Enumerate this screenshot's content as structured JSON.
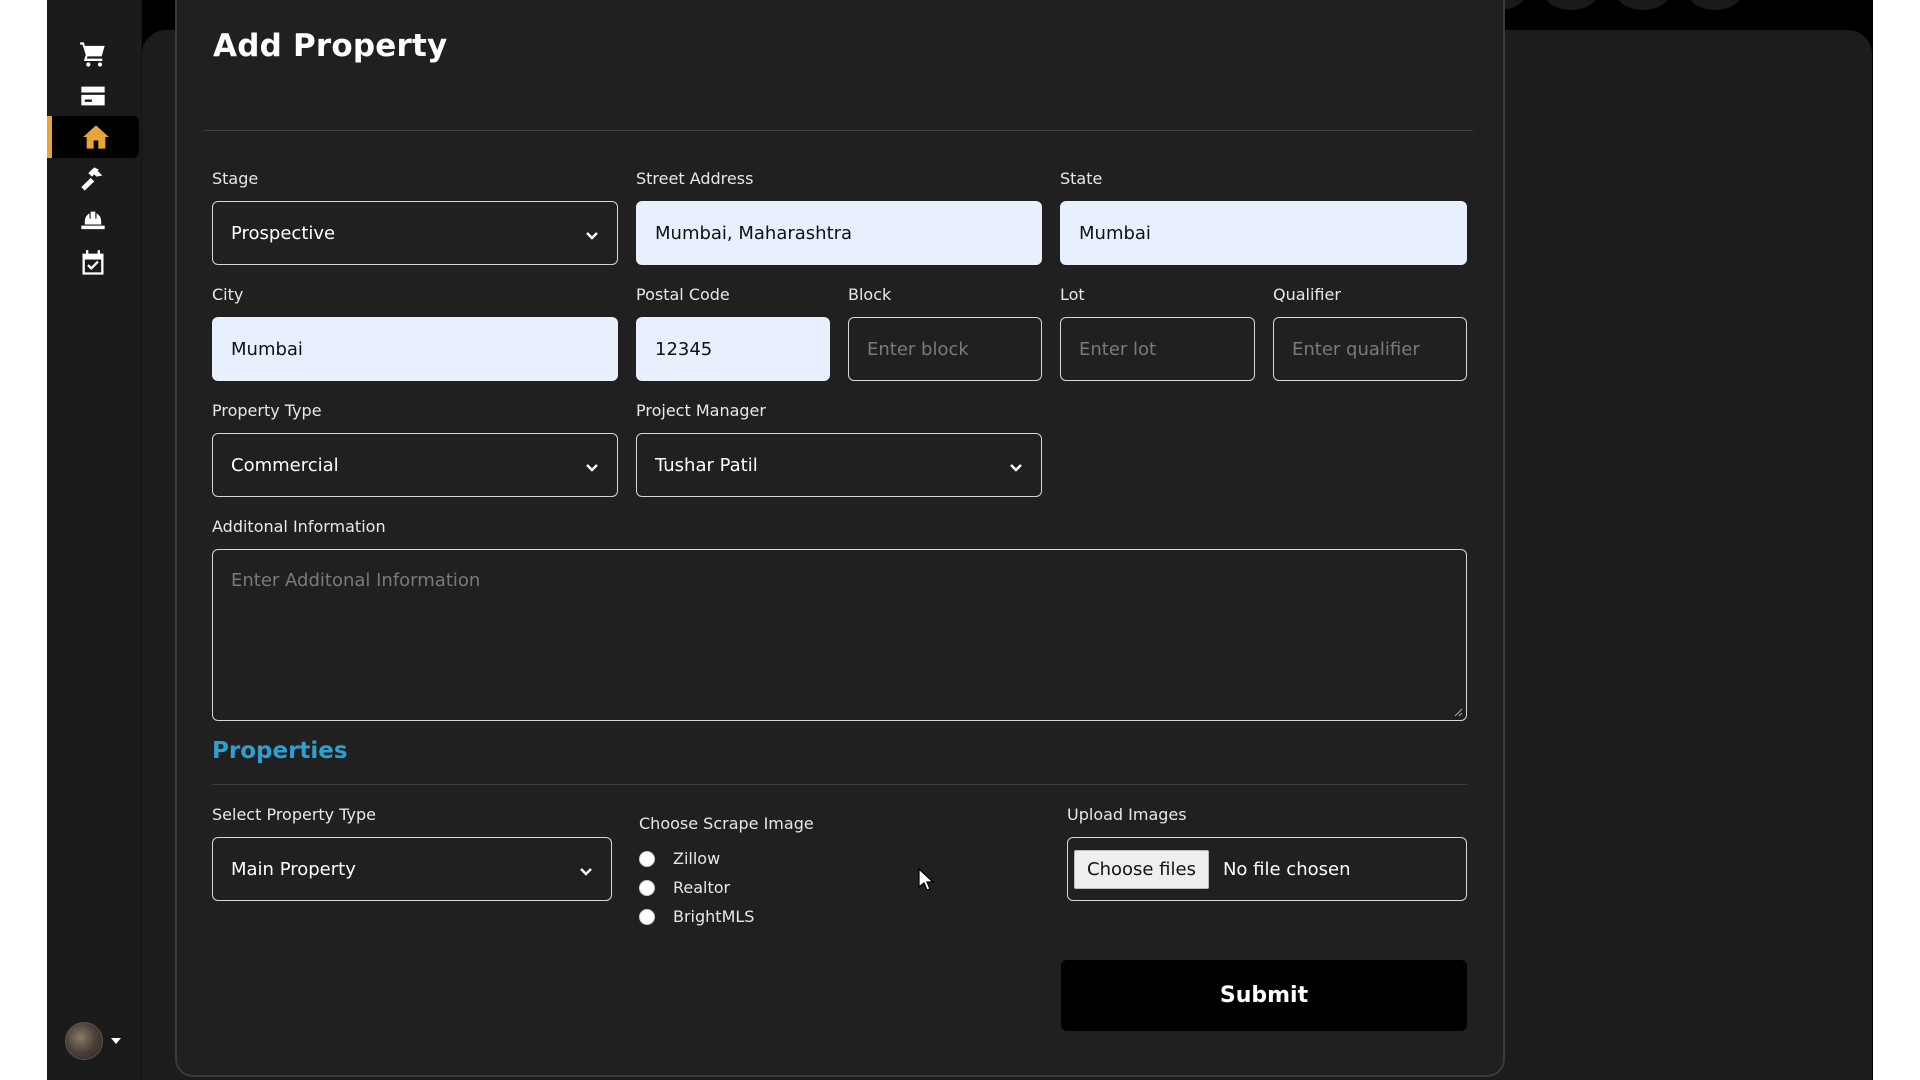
{
  "page": {
    "title": "Add Property"
  },
  "sidebar": {
    "items": [
      {
        "icon": "cart-icon"
      },
      {
        "icon": "credit-card-icon"
      },
      {
        "icon": "home-icon",
        "active": true
      },
      {
        "icon": "hammer-icon"
      },
      {
        "icon": "hard-hat-icon"
      },
      {
        "icon": "calendar-check-icon"
      }
    ],
    "active_color": "#e8a33a"
  },
  "form": {
    "stage": {
      "label": "Stage",
      "value": "Prospective"
    },
    "street_address": {
      "label": "Street Address",
      "value": "Mumbai, Maharashtra"
    },
    "state": {
      "label": "State",
      "value": "Mumbai"
    },
    "city": {
      "label": "City",
      "value": "Mumbai"
    },
    "postal_code": {
      "label": "Postal Code",
      "value": "12345"
    },
    "block": {
      "label": "Block",
      "placeholder": "Enter block"
    },
    "lot": {
      "label": "Lot",
      "placeholder": "Enter lot"
    },
    "qualifier": {
      "label": "Qualifier",
      "placeholder": "Enter qualifier"
    },
    "property_type": {
      "label": "Property Type",
      "value": "Commercial"
    },
    "project_manager": {
      "label": "Project Manager",
      "value": "Tushar Patil"
    },
    "additional_info": {
      "label": "Additonal Information",
      "placeholder": "Enter Additonal Information"
    }
  },
  "properties": {
    "section_title": "Properties",
    "section_color": "#2f9fd0",
    "select_type": {
      "label": "Select Property Type",
      "value": "Main Property"
    },
    "scrape": {
      "label": "Choose Scrape Image",
      "options": [
        "Zillow",
        "Realtor",
        "BrightMLS"
      ]
    },
    "upload": {
      "label": "Upload Images",
      "button": "Choose files",
      "status": "No file chosen"
    }
  },
  "submit_label": "Submit"
}
